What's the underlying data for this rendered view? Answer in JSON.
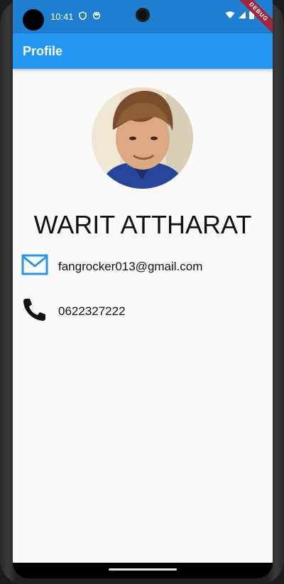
{
  "status_bar": {
    "time": "10:41",
    "debug_banner": "DEBUG"
  },
  "app_bar": {
    "title": "Profile"
  },
  "profile": {
    "name": "WARIT ATTHARAT",
    "email": "fangrocker013@gmail.com",
    "phone": "0622327222"
  },
  "colors": {
    "app_bar": "#2196f3",
    "status_bar": "#1e7fd1",
    "email_icon": "#2196f3",
    "phone_icon": "#111111"
  },
  "icons": {
    "email": "mail-icon",
    "phone": "phone-icon"
  }
}
